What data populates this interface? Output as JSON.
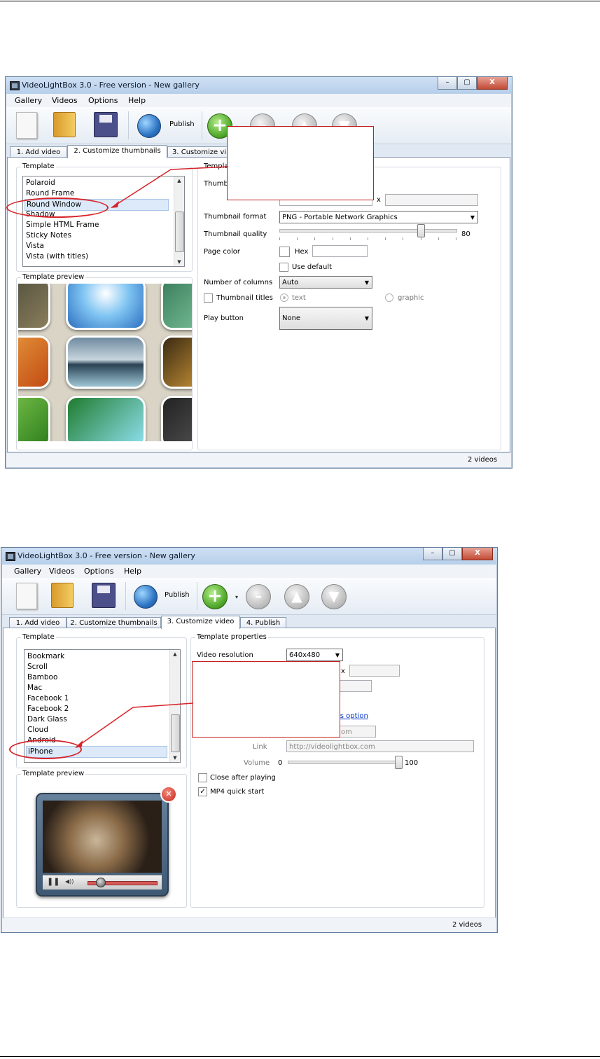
{
  "window": {
    "title": "VideoLightBox 3.0 - Free version - New gallery",
    "minimize_label": "–",
    "maximize_label": "▢",
    "close_label": "X"
  },
  "menu": [
    "Gallery",
    "Videos",
    "Options",
    "Help"
  ],
  "toolbar": {
    "publish_label": "Publish",
    "add_symbol": "+",
    "remove_symbol": "–",
    "up_symbol": "▲",
    "down_symbol": "▼",
    "dropdown_symbol": "▾"
  },
  "tabs": [
    "1. Add video",
    "2. Customize thumbnails",
    "3. Customize video",
    "4. Publish"
  ],
  "tabs_truncated": "3. Customize vi",
  "status": {
    "videos_count": "2 videos"
  },
  "screen1": {
    "template_group": "Template",
    "properties_group_partial": "Templa",
    "template_list": [
      "Polaroid",
      "Round Frame",
      "Round Window",
      "Shadow",
      "Simple HTML Frame",
      "Sticky Notes",
      "Vista",
      "Vista (with titles)"
    ],
    "selected_template": "Round Window",
    "thumbnail_size_label_partial": "Thumbn",
    "size_separator": "x",
    "thumbnail_format_label": "Thumbnail format",
    "thumbnail_format_value": "PNG - Portable Network Graphics",
    "thumbnail_quality_label": "Thumbnail quality",
    "thumbnail_quality_value": "80",
    "page_color_label": "Page color",
    "hex_label": "Hex",
    "use_default_label": "Use default",
    "columns_label": "Number of columns",
    "columns_value": "Auto",
    "thumbnail_titles_label": "Thumbnail titles",
    "text_option": "text",
    "graphic_option": "graphic",
    "play_button_label": "Play button",
    "play_button_value": "None",
    "preview_group": "Template preview",
    "quality_fraction": 0.8
  },
  "screen2": {
    "template_group": "Template",
    "properties_group": "Template properties",
    "template_list": [
      "Bookmark",
      "Scroll",
      "Bamboo",
      "Mac",
      "Facebook 1",
      "Facebook 2",
      "Dark Glass",
      "Cloud",
      "Android",
      "iPhone"
    ],
    "selected_template": "iPhone",
    "video_resolution_label": "Video resolution",
    "video_resolution_value": "640x480",
    "size_separator": "x",
    "option_link_partial": "is option",
    "hidden_field_partial": "om",
    "link_label": "Link",
    "link_value": "http://videolightbox.com",
    "volume_label": "Volume",
    "volume_min": "0",
    "volume_max": "100",
    "volume_fraction": 1.0,
    "close_after_playing_label": "Close after playing",
    "close_after_playing_checked": false,
    "mp4_quick_start_label": "MP4 quick start",
    "mp4_quick_start_checked": true,
    "checkmark": "✓",
    "preview_group": "Template preview",
    "player_close_symbol": "✕",
    "player_pause_symbol": "❚❚",
    "player_volume_symbol": "◀))",
    "progress_fraction": 0.18
  }
}
